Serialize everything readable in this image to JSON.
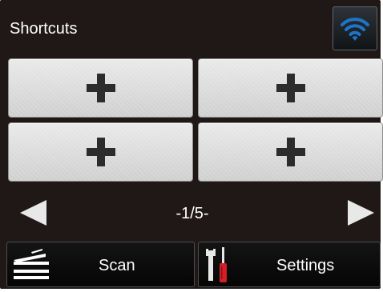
{
  "header": {
    "title": "Shortcuts",
    "wifi_icon": "wifi-icon"
  },
  "shortcuts": [
    {
      "icon": "plus-icon"
    },
    {
      "icon": "plus-icon"
    },
    {
      "icon": "plus-icon"
    },
    {
      "icon": "plus-icon"
    }
  ],
  "pager": {
    "page_label": "-1/5-",
    "prev_icon": "left-arrow-icon",
    "next_icon": "right-arrow-icon"
  },
  "bottom": {
    "scan": {
      "label": "Scan",
      "icon": "scan-icon"
    },
    "settings": {
      "label": "Settings",
      "icon": "settings-tools-icon"
    }
  },
  "colors": {
    "background": "#1f1817",
    "button_face": "#dcdcdc",
    "wifi_blue": "#1e74c9",
    "screwdriver_red": "#d51f26"
  }
}
